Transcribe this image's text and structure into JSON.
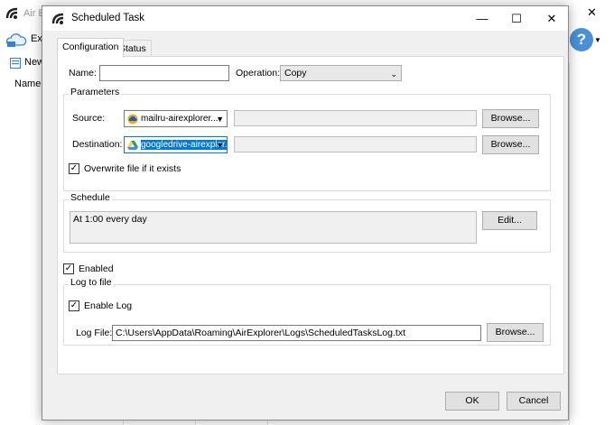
{
  "background_app": {
    "title": "Air Ex",
    "toolbar_explore_label": "Exp",
    "new_label": "New",
    "column_header_name": "Name",
    "help_label": "?"
  },
  "dialog": {
    "title": "Scheduled Task",
    "tabs": [
      {
        "label": "Configuration",
        "active": true
      },
      {
        "label": "Status",
        "active": false
      }
    ],
    "name": {
      "label": "Name:",
      "value": ""
    },
    "operation": {
      "label": "Operation:",
      "value": "Copy"
    },
    "parameters": {
      "group_title": "Parameters",
      "source": {
        "label": "Source:",
        "account": "mailru-airexplorer...",
        "path": "",
        "browse_label": "Browse..."
      },
      "destination": {
        "label": "Destination:",
        "account": "googledrive-airexplor...",
        "path": "",
        "browse_label": "Browse..."
      },
      "overwrite": {
        "label": "Overwrite file if it exists",
        "checked": true
      }
    },
    "schedule": {
      "group_title": "Schedule",
      "text": "At 1:00 every day",
      "edit_label": "Edit..."
    },
    "enabled": {
      "label": "Enabled",
      "checked": true
    },
    "log": {
      "group_title": "Log to file",
      "enable": {
        "label": "Enable Log",
        "checked": true
      },
      "file_label": "Log File:",
      "file_value": "C:\\Users\\AppData\\Roaming\\AirExplorer\\Logs\\ScheduledTasksLog.txt",
      "browse_label": "Browse..."
    },
    "ok_label": "OK",
    "cancel_label": "Cancel",
    "window_buttons": {
      "minimize": "—",
      "maximize": "☐",
      "close": "✕"
    }
  },
  "colors": {
    "accent": "#0078d7",
    "mailru_icon": "#f5a623",
    "gdrive_green": "#1fa463",
    "gdrive_yellow": "#ffd04b",
    "gdrive_blue": "#4688f4",
    "help_blue": "#4a90d9"
  },
  "icons": {
    "app_logo": "air-explorer-logo-icon",
    "mailru": "mailru-cloud-icon",
    "googledrive": "google-drive-icon",
    "checkmark": "✓",
    "dropdown": "▼"
  }
}
